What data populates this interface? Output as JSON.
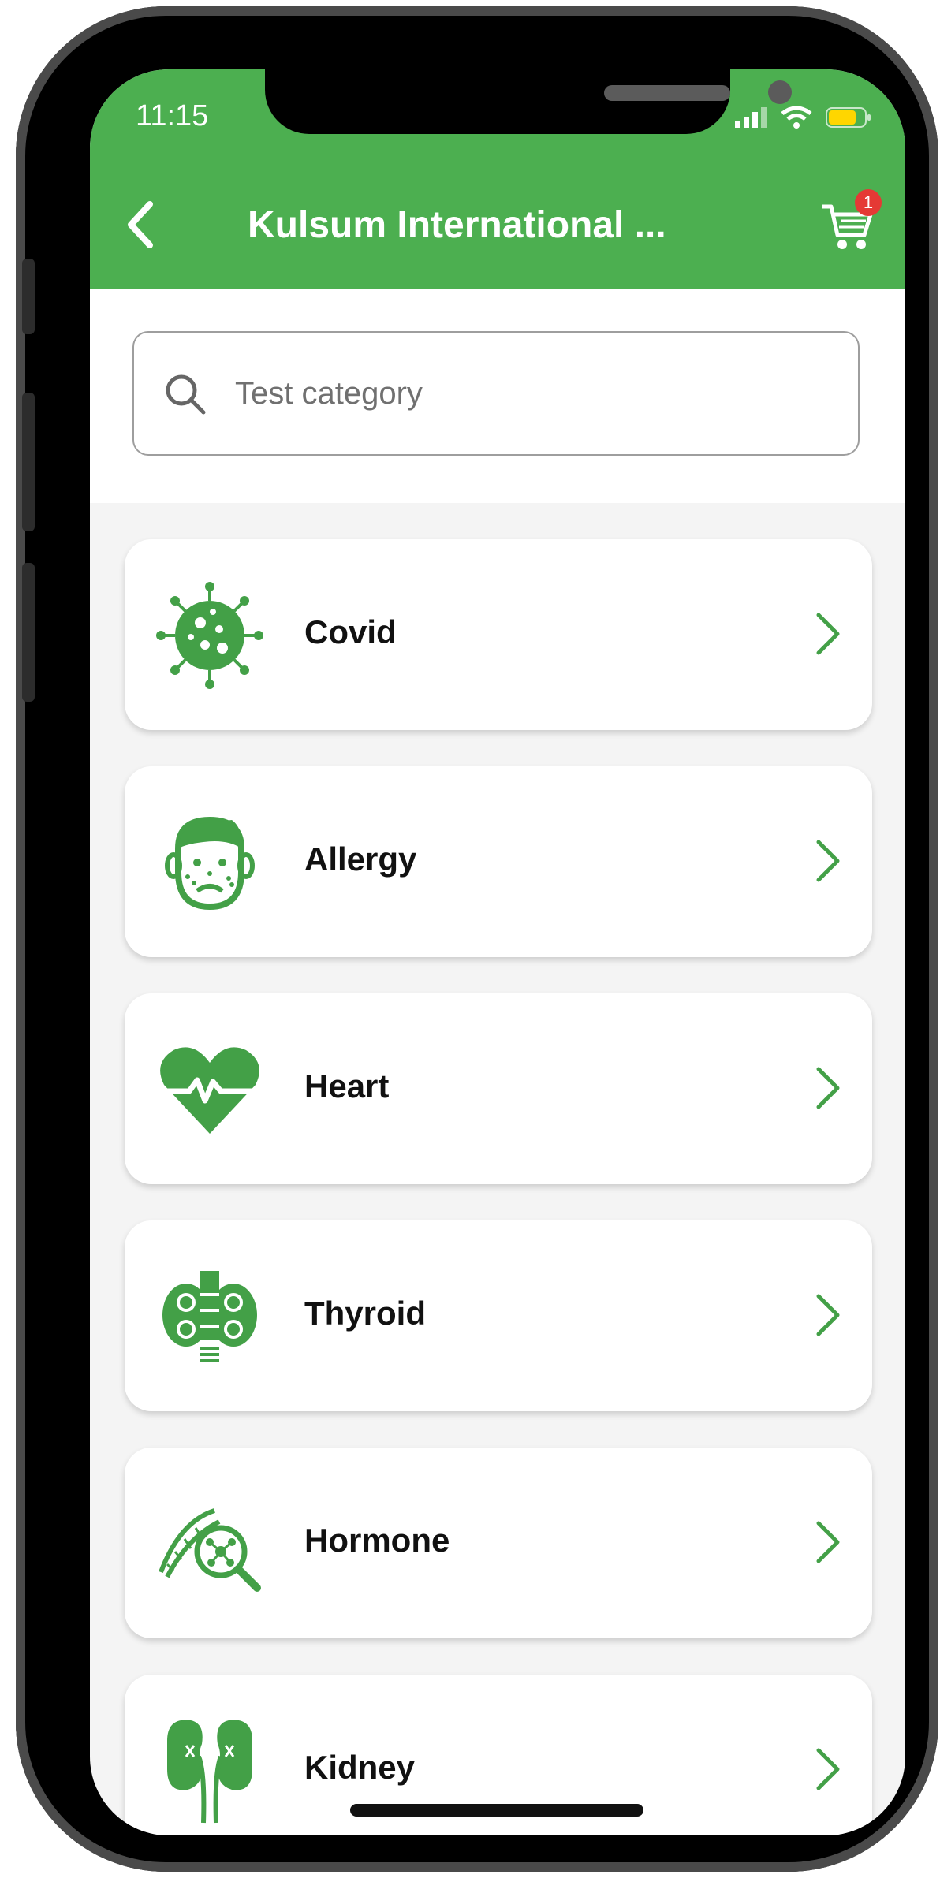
{
  "status_bar": {
    "time": "11:15"
  },
  "header": {
    "title": "Kulsum International ...",
    "cart_count": "1",
    "back_icon": "chevron-left-icon",
    "cart_icon": "cart-icon"
  },
  "search": {
    "placeholder": "Test category",
    "value": ""
  },
  "categories": [
    {
      "label": "Covid",
      "icon": "virus-icon"
    },
    {
      "label": "Allergy",
      "icon": "allergy-face-icon"
    },
    {
      "label": "Heart",
      "icon": "heart-pulse-icon"
    },
    {
      "label": "Thyroid",
      "icon": "thyroid-icon"
    },
    {
      "label": "Hormone",
      "icon": "hormone-dna-magnifier-icon"
    },
    {
      "label": "Kidney",
      "icon": "kidney-icon"
    }
  ],
  "colors": {
    "primary": "#4caf50",
    "icon_green": "#43a047",
    "badge_red": "#e53935"
  }
}
